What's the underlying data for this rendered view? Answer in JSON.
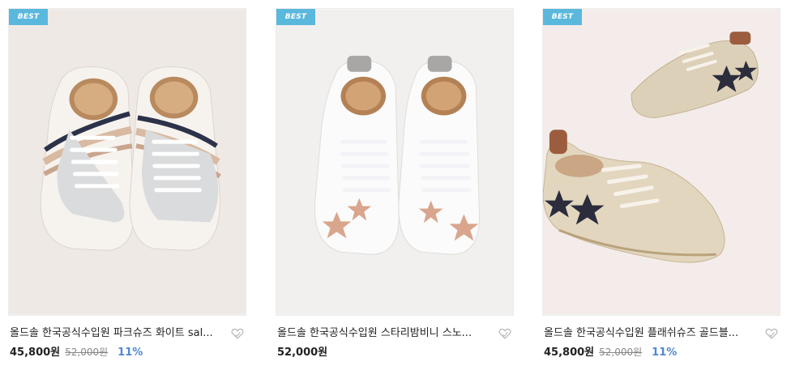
{
  "products": [
    {
      "badge": "BEST",
      "title": "올드솔 한국공식수입원 파크슈즈 화이트 sal...",
      "price": "45,800원",
      "original_price": "52,000원",
      "discount": "11%",
      "image_icon": "baby-sneaker-white-stripe-image",
      "wishlist_icon": "heart-outline-icon"
    },
    {
      "badge": "BEST",
      "title": "올드솔 한국공식수입원 스타리밤비니 스노...",
      "price": "52,000원",
      "image_icon": "baby-sneaker-white-star-image",
      "wishlist_icon": "heart-outline-icon"
    },
    {
      "badge": "BEST",
      "title": "올드솔 한국공식수입원 플래쉬슈즈 골드블...",
      "price": "45,800원",
      "original_price": "52,000원",
      "discount": "11%",
      "image_icon": "baby-sneaker-gold-star-image",
      "wishlist_icon": "heart-outline-icon"
    }
  ],
  "colors": {
    "badge_bg": "#5bb8dd",
    "discount": "#4f87d6",
    "price": "#222222",
    "original_price": "#888888"
  }
}
